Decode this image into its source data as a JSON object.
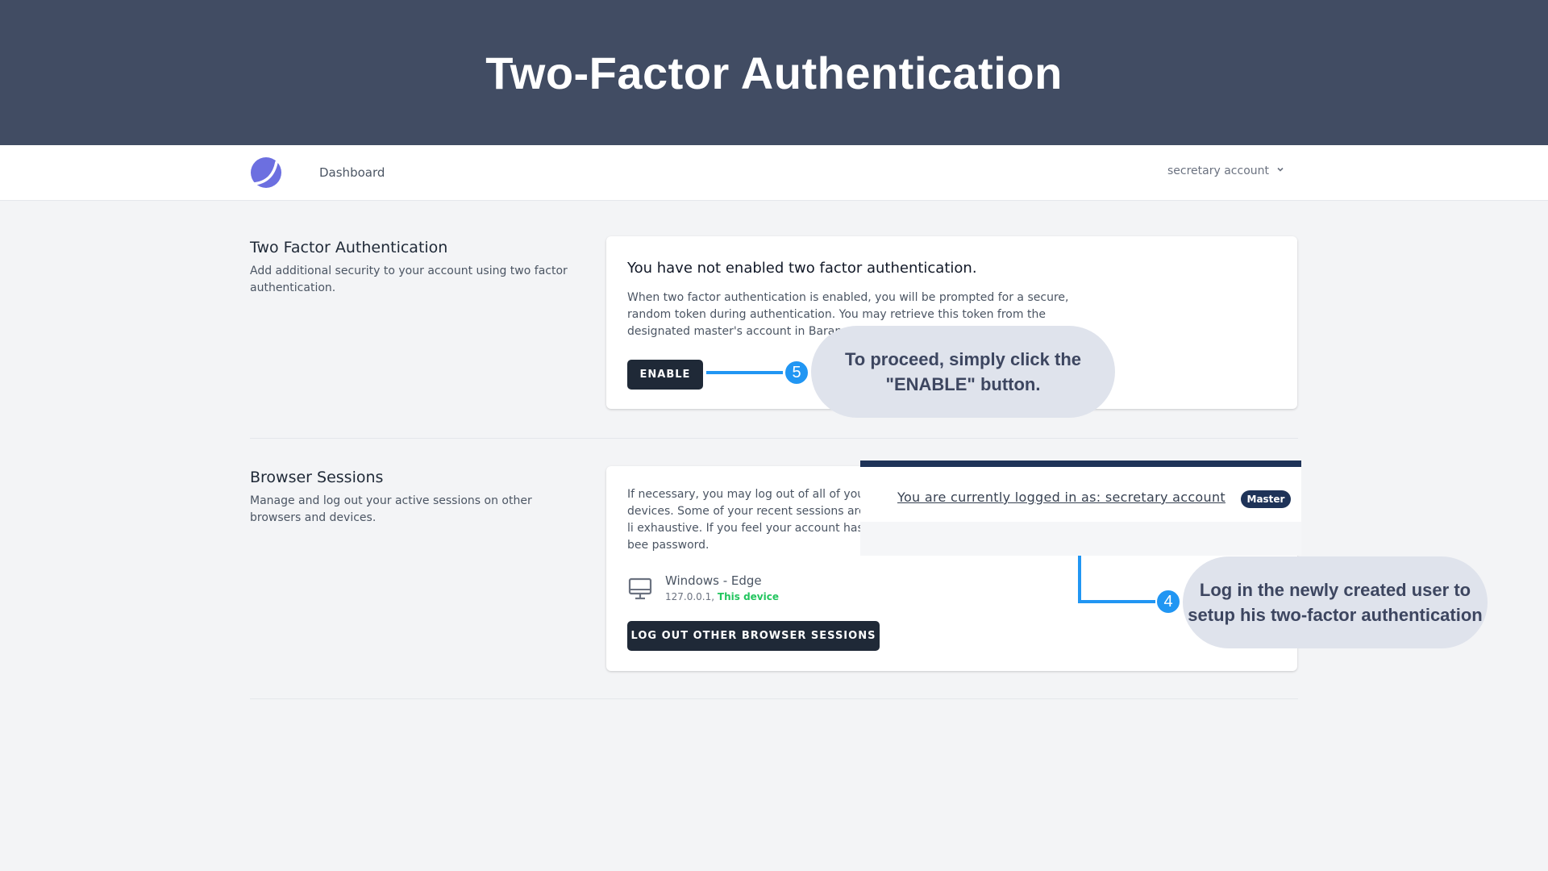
{
  "banner": {
    "title": "Two-Factor Authentication"
  },
  "nav": {
    "links": [
      "Dashboard"
    ],
    "account_name": "secretary account"
  },
  "two_factor": {
    "title": "Two Factor Authentication",
    "description": "Add additional security to your account using two factor authentication.",
    "status_heading": "You have not enabled two factor authentication.",
    "body": "When two factor authentication is enabled, you will be prompted for a secure, random token during authentication. You may retrieve this token from the designated master's account in Barangay 385 office.",
    "enable_button": "ENABLE"
  },
  "browser_sessions": {
    "title": "Browser Sessions",
    "description": "Manage and log out your active sessions on other browsers and devices.",
    "body_partial": "If necessary, you may log out of all of your devices. Some of your recent sessions are li exhaustive. If you feel your account has bee password.",
    "session": {
      "device": "Windows - Edge",
      "ip": "127.0.0.1,",
      "this_device": "This device"
    },
    "logout_button": "LOG OUT OTHER BROWSER SESSIONS"
  },
  "login_overlay": {
    "text": "You are currently logged in as: secretary account",
    "badge": "Master"
  },
  "callouts": [
    {
      "step": "5",
      "text": "To proceed, simply click the \"ENABLE\" button."
    },
    {
      "step": "4",
      "text": "Log in the newly created user to setup his two-factor authentication"
    }
  ],
  "colors": {
    "banner_bg": "#414c63",
    "callout_bg": "#dfe3ec",
    "step_blue": "#2196f3",
    "button_dark": "#1f2937",
    "logo_purple": "#6c6fe0",
    "badge_navy": "#1e3358"
  },
  "icons": [
    "logo-icon",
    "chevron-down-icon",
    "desktop-icon"
  ]
}
